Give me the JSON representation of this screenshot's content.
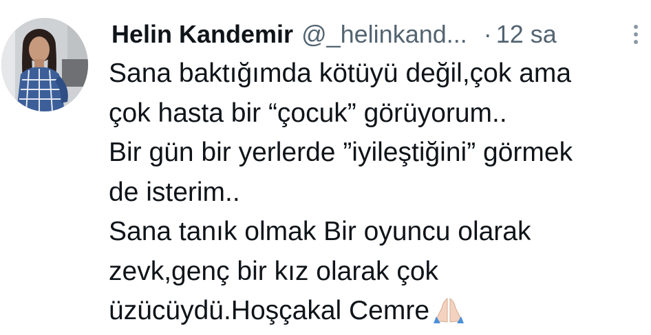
{
  "tweet": {
    "display_name": "Helin Kandemir",
    "handle": "@_helinkand...",
    "separator": "·",
    "time": "12 sa",
    "lines": [
      "Sana baktığımda kötüyü değil,çok ama",
      "çok hasta bir  “çocuk” görüyorum..",
      "Bir gün bir yerlerde ”iyileştiğini” görmek",
      "de isterim..",
      "Sana tanık olmak Bir oyuncu olarak",
      "zevk,genç bir kız olarak çok",
      "üzücüydü.Hoşçakal Cemre"
    ],
    "emoji": "folded-hands-icon",
    "more_icon": "more-vertical-icon"
  },
  "colors": {
    "text": "#0f1419",
    "secondary": "#536471"
  }
}
